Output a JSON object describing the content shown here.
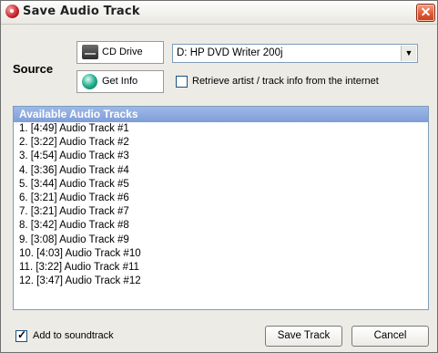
{
  "window": {
    "title": "Save Audio Track",
    "close_glyph": "✕"
  },
  "source": {
    "label": "Source",
    "cd_drive_button": "CD Drive",
    "get_info_button": "Get Info",
    "drive_select_value": "D: HP DVD Writer 200j",
    "retrieve_checkbox_label": "Retrieve artist / track info from the internet",
    "retrieve_checked": false
  },
  "tracks": {
    "header": "Available Audio Tracks",
    "items": [
      "1. [4:49] Audio Track #1",
      "2. [3:22] Audio Track #2",
      "3. [4:54] Audio Track #3",
      "4. [3:36] Audio Track #4",
      "5. [3:44] Audio Track #5",
      "6. [3:21] Audio Track #6",
      "7. [3:21] Audio Track #7",
      "8. [3:42] Audio Track #8",
      "9. [3:08] Audio Track #9",
      "10. [4:03] Audio Track #10",
      "11. [3:22] Audio Track #11",
      "12. [3:47] Audio Track #12"
    ]
  },
  "footer": {
    "add_to_soundtrack_label": "Add to soundtrack",
    "add_to_soundtrack_checked": true,
    "save_button": "Save Track",
    "cancel_button": "Cancel"
  },
  "colors": {
    "list_header": "#8aa8e0",
    "close_button": "#df5a37",
    "window_bg": "#ecebe6"
  }
}
